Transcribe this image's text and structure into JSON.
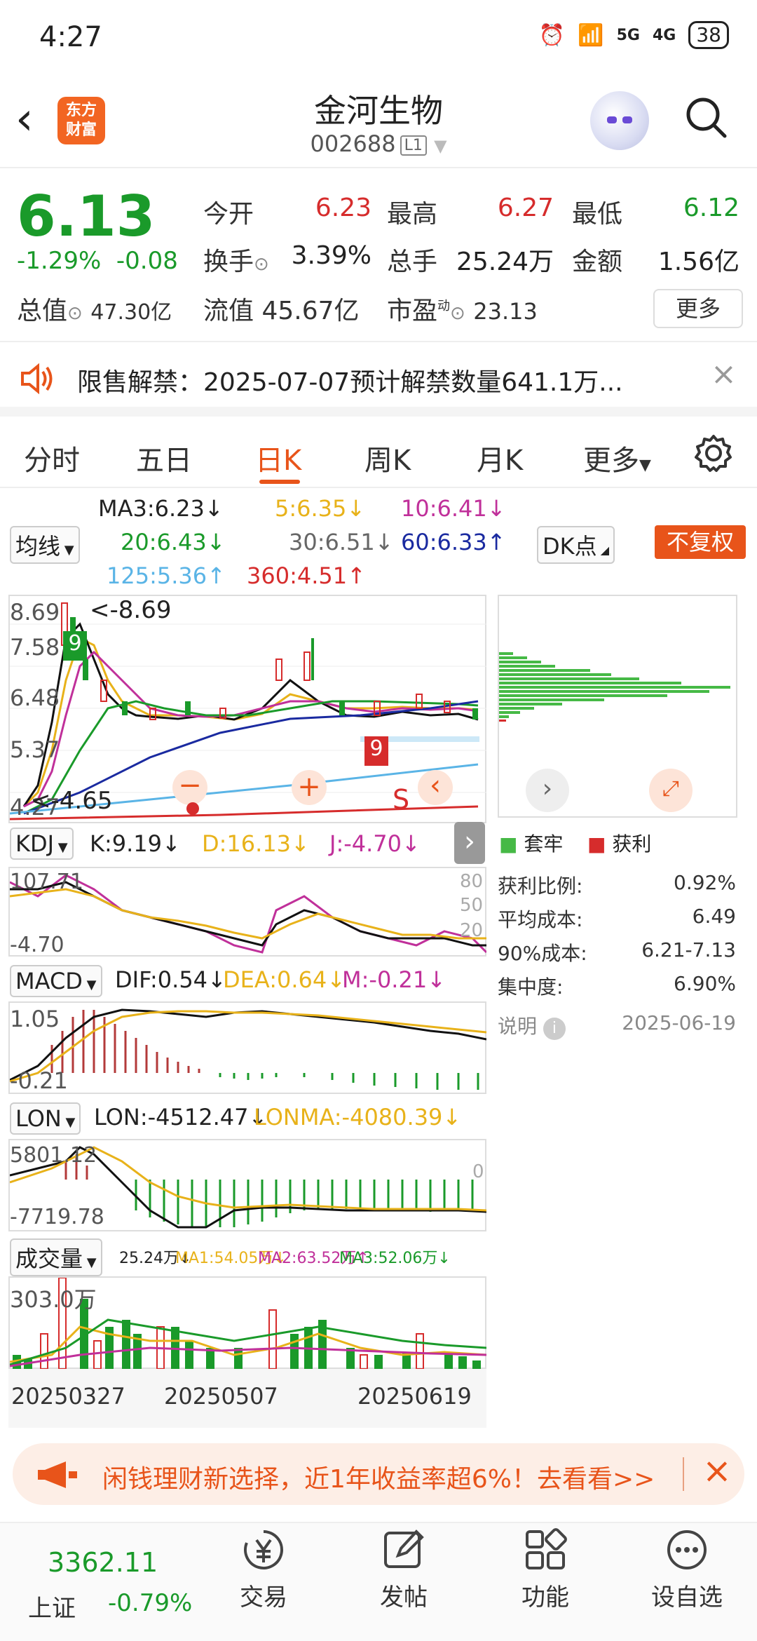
{
  "status": {
    "time": "4:27",
    "battery": "38",
    "signal1": "5G",
    "signal2": "4G"
  },
  "header": {
    "stock_name": "金河生物",
    "stock_code": "002688",
    "code_tag": "L1",
    "logo": "东方财富"
  },
  "quote": {
    "price": "6.13",
    "change_pct": "-1.29%",
    "change": "-0.08",
    "open_label": "今开",
    "open": "6.23",
    "high_label": "最高",
    "high": "6.27",
    "low_label": "最低",
    "low": "6.12",
    "turnover_label": "换手",
    "turnover": "3.39%",
    "volume_label": "总手",
    "volume": "25.24万",
    "amount_label": "金额",
    "amount": "1.56亿",
    "mktcap_label": "总值",
    "mktcap": "47.30亿",
    "float_label": "流值",
    "float_cap": "45.67亿",
    "pe_label": "市盈",
    "pe_sup": "动",
    "pe": "23.13",
    "more_label": "更多"
  },
  "notice": {
    "text": "限售解禁：2025-07-07预计解禁数量641.1万..."
  },
  "tabs": [
    "分时",
    "五日",
    "日K",
    "周K",
    "月K",
    "更多"
  ],
  "ma": {
    "selector": "均线",
    "ma3": "MA3:6.23↓",
    "ma5": "5:6.35↓",
    "ma10": "10:6.41↓",
    "ma20": "20:6.43↓",
    "ma30": "30:6.51↓",
    "ma60": "60:6.33↑",
    "ma125": "125:5.36↑",
    "ma360": "360:4.51↑",
    "dk_label": "DK点",
    "fq_label": "不复权"
  },
  "kline": {
    "y_labels": [
      "8.69",
      "7.58",
      "6.48",
      "5.37",
      "4.27"
    ],
    "high_marker": "<-8.69",
    "low_marker": "<-4.65",
    "signal_s": "S",
    "count_9": "9"
  },
  "kdj": {
    "selector": "KDJ",
    "k": "K:9.19↓",
    "d": "D:16.13↓",
    "j": "J:-4.70↓",
    "y_top": "107.71",
    "y_bottom": "-4.70",
    "r80": "80",
    "r50": "50",
    "r20": "20"
  },
  "macd": {
    "selector": "MACD",
    "dif": "DIF:0.54↓",
    "dea": "DEA:0.64↓",
    "m": "M:-0.21↓",
    "y_top": "1.05",
    "y_bottom": "-0.21"
  },
  "lon": {
    "selector": "LON",
    "lon": "LON:-4512.47↓",
    "lonma": "LONMA:-4080.39↓",
    "y_top": "5801.12",
    "y_bottom": "-7719.78",
    "zero": "0"
  },
  "vol": {
    "selector": "成交量",
    "vol": "25.24万↓",
    "ma1": "MA1:54.05万↓",
    "ma2": "MA2:63.52万↑",
    "ma3": "MA3:52.06万↓",
    "y_top": "303.0万"
  },
  "dates": [
    "20250327",
    "20250507",
    "20250619"
  ],
  "chips": {
    "legend_trapped": "套牢",
    "legend_profit": "获利",
    "rows": [
      {
        "label": "获利比例:",
        "value": "0.92%"
      },
      {
        "label": "平均成本:",
        "value": "6.49"
      },
      {
        "label": "90%成本:",
        "value": "6.21-7.13"
      },
      {
        "label": "集中度:",
        "value": "6.90%"
      }
    ],
    "note_label": "说明",
    "note_date": "2025-06-19"
  },
  "ad": {
    "text": "闲钱理财新选择，近1年收益率超6%！去看看>>"
  },
  "bottom": {
    "index_value": "3362.11",
    "index_name": "上证",
    "index_change": "-0.79%",
    "items": [
      "交易",
      "发帖",
      "功能",
      "设自选"
    ]
  },
  "colors": {
    "accent": "#e8541a",
    "up": "#d62c2c",
    "down": "#1a9a2a"
  }
}
